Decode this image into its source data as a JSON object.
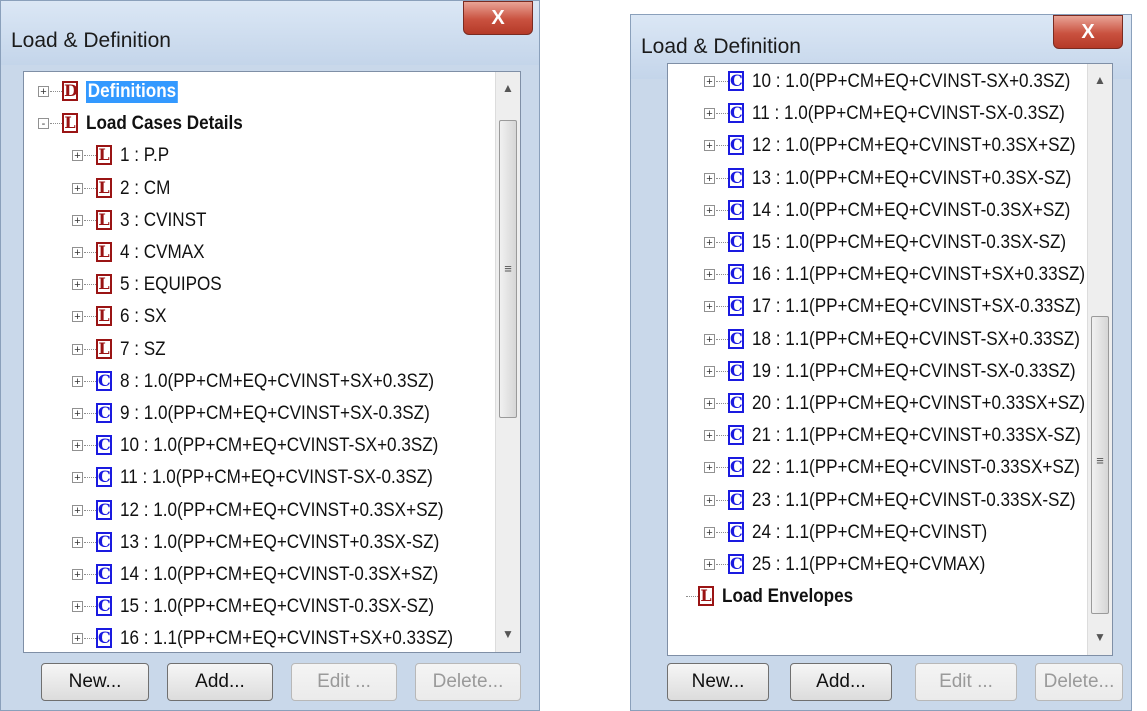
{
  "left_window": {
    "title": "Load & Definition",
    "close_label": "X",
    "tree": [
      {
        "toggle": "+",
        "icon": "D",
        "label": "Definitions",
        "indent": 0,
        "bold": true,
        "selected": true
      },
      {
        "toggle": "-",
        "icon": "L",
        "label": "Load Cases Details",
        "indent": 0,
        "bold": true,
        "selected": false
      },
      {
        "toggle": "+",
        "icon": "L",
        "label": "1 : P.P",
        "indent": 1
      },
      {
        "toggle": "+",
        "icon": "L",
        "label": "2 : CM",
        "indent": 1
      },
      {
        "toggle": "+",
        "icon": "L",
        "label": "3 : CVINST",
        "indent": 1
      },
      {
        "toggle": "+",
        "icon": "L",
        "label": "4 : CVMAX",
        "indent": 1
      },
      {
        "toggle": "+",
        "icon": "L",
        "label": "5 : EQUIPOS",
        "indent": 1
      },
      {
        "toggle": "+",
        "icon": "L",
        "label": "6 : SX",
        "indent": 1
      },
      {
        "toggle": "+",
        "icon": "L",
        "label": "7 : SZ",
        "indent": 1
      },
      {
        "toggle": "+",
        "icon": "C",
        "label": "8 : 1.0(PP+CM+EQ+CVINST+SX+0.3SZ)",
        "indent": 1
      },
      {
        "toggle": "+",
        "icon": "C",
        "label": "9 : 1.0(PP+CM+EQ+CVINST+SX-0.3SZ)",
        "indent": 1
      },
      {
        "toggle": "+",
        "icon": "C",
        "label": "10 : 1.0(PP+CM+EQ+CVINST-SX+0.3SZ)",
        "indent": 1
      },
      {
        "toggle": "+",
        "icon": "C",
        "label": "11 : 1.0(PP+CM+EQ+CVINST-SX-0.3SZ)",
        "indent": 1
      },
      {
        "toggle": "+",
        "icon": "C",
        "label": "12 : 1.0(PP+CM+EQ+CVINST+0.3SX+SZ)",
        "indent": 1
      },
      {
        "toggle": "+",
        "icon": "C",
        "label": "13 : 1.0(PP+CM+EQ+CVINST+0.3SX-SZ)",
        "indent": 1
      },
      {
        "toggle": "+",
        "icon": "C",
        "label": "14 : 1.0(PP+CM+EQ+CVINST-0.3SX+SZ)",
        "indent": 1
      },
      {
        "toggle": "+",
        "icon": "C",
        "label": "15 : 1.0(PP+CM+EQ+CVINST-0.3SX-SZ)",
        "indent": 1
      },
      {
        "toggle": "+",
        "icon": "C",
        "label": "16 : 1.1(PP+CM+EQ+CVINST+SX+0.33SZ)",
        "indent": 1
      }
    ],
    "buttons": [
      {
        "label": "New...",
        "enabled": true,
        "name": "new-button"
      },
      {
        "label": "Add...",
        "enabled": true,
        "name": "add-button"
      },
      {
        "label": "Edit ...",
        "enabled": false,
        "name": "edit-button"
      },
      {
        "label": "Delete...",
        "enabled": false,
        "name": "delete-button"
      }
    ]
  },
  "right_window": {
    "title": "Load & Definition",
    "close_label": "X",
    "tree": [
      {
        "toggle": "+",
        "icon": "C",
        "label": "10 : 1.0(PP+CM+EQ+CVINST-SX+0.3SZ)",
        "indent": 1
      },
      {
        "toggle": "+",
        "icon": "C",
        "label": "11 : 1.0(PP+CM+EQ+CVINST-SX-0.3SZ)",
        "indent": 1
      },
      {
        "toggle": "+",
        "icon": "C",
        "label": "12 : 1.0(PP+CM+EQ+CVINST+0.3SX+SZ)",
        "indent": 1
      },
      {
        "toggle": "+",
        "icon": "C",
        "label": "13 : 1.0(PP+CM+EQ+CVINST+0.3SX-SZ)",
        "indent": 1
      },
      {
        "toggle": "+",
        "icon": "C",
        "label": "14 : 1.0(PP+CM+EQ+CVINST-0.3SX+SZ)",
        "indent": 1
      },
      {
        "toggle": "+",
        "icon": "C",
        "label": "15 : 1.0(PP+CM+EQ+CVINST-0.3SX-SZ)",
        "indent": 1
      },
      {
        "toggle": "+",
        "icon": "C",
        "label": "16 : 1.1(PP+CM+EQ+CVINST+SX+0.33SZ)",
        "indent": 1
      },
      {
        "toggle": "+",
        "icon": "C",
        "label": "17 : 1.1(PP+CM+EQ+CVINST+SX-0.33SZ)",
        "indent": 1
      },
      {
        "toggle": "+",
        "icon": "C",
        "label": "18 : 1.1(PP+CM+EQ+CVINST-SX+0.33SZ)",
        "indent": 1
      },
      {
        "toggle": "+",
        "icon": "C",
        "label": "19 : 1.1(PP+CM+EQ+CVINST-SX-0.33SZ)",
        "indent": 1
      },
      {
        "toggle": "+",
        "icon": "C",
        "label": "20 : 1.1(PP+CM+EQ+CVINST+0.33SX+SZ)",
        "indent": 1
      },
      {
        "toggle": "+",
        "icon": "C",
        "label": "21 : 1.1(PP+CM+EQ+CVINST+0.33SX-SZ)",
        "indent": 1
      },
      {
        "toggle": "+",
        "icon": "C",
        "label": "22 : 1.1(PP+CM+EQ+CVINST-0.33SX+SZ)",
        "indent": 1
      },
      {
        "toggle": "+",
        "icon": "C",
        "label": "23 : 1.1(PP+CM+EQ+CVINST-0.33SX-SZ)",
        "indent": 1
      },
      {
        "toggle": "+",
        "icon": "C",
        "label": "24 : 1.1(PP+CM+EQ+CVINST)",
        "indent": 1
      },
      {
        "toggle": "+",
        "icon": "C",
        "label": "25 : 1.1(PP+CM+EQ+CVMAX)",
        "indent": 1
      },
      {
        "toggle": "",
        "icon": "L",
        "label": "Load Envelopes",
        "indent": 0,
        "bold": true,
        "selected": false
      }
    ],
    "buttons": [
      {
        "label": "New...",
        "enabled": true,
        "name": "new-button"
      },
      {
        "label": "Add...",
        "enabled": true,
        "name": "add-button"
      },
      {
        "label": "Edit ...",
        "enabled": false,
        "name": "edit-button"
      },
      {
        "label": "Delete...",
        "enabled": false,
        "name": "delete-button"
      }
    ]
  },
  "colors": {
    "load_icon": "#9a1414",
    "combination_icon": "#1a1ae0",
    "selection": "#3399ff"
  }
}
